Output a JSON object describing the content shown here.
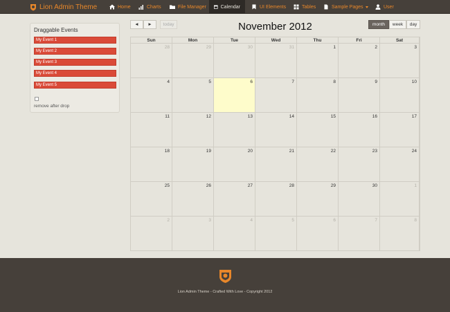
{
  "brand": {
    "name": "Lion Admin Theme",
    "color": "#e8872a"
  },
  "nav": {
    "items": [
      {
        "label": "Home",
        "icon": "home-icon"
      },
      {
        "label": "Charts",
        "icon": "chart-icon"
      },
      {
        "label": "File Manager",
        "icon": "folder-icon"
      },
      {
        "label": "Calendar",
        "icon": "calendar-icon",
        "active": true
      },
      {
        "label": "UI Elements",
        "icon": "bookmark-icon"
      },
      {
        "label": "Tables",
        "icon": "table-icon"
      },
      {
        "label": "Sample Pages",
        "icon": "file-icon",
        "dropdown": true
      },
      {
        "label": "User",
        "icon": "user-icon"
      }
    ]
  },
  "sidebar": {
    "title": "Draggable Events",
    "events": [
      "My Event 1",
      "My Event 2",
      "My Event 3",
      "My Event 4",
      "My Event 5"
    ],
    "remove_label": "remove after drop",
    "remove_checked": false,
    "event_color": "#da4a38"
  },
  "calendar": {
    "title": "November 2012",
    "prev_symbol": "◄",
    "next_symbol": "►",
    "today_label": "today",
    "views": [
      "month",
      "week",
      "day"
    ],
    "active_view": "month",
    "weekdays": [
      "Sun",
      "Mon",
      "Tue",
      "Wed",
      "Thu",
      "Fri",
      "Sat"
    ],
    "weeks": [
      [
        28,
        29,
        30,
        31,
        1,
        2,
        3
      ],
      [
        4,
        5,
        6,
        7,
        8,
        9,
        10
      ],
      [
        11,
        12,
        13,
        14,
        15,
        16,
        17
      ],
      [
        18,
        19,
        20,
        21,
        22,
        23,
        24
      ],
      [
        25,
        26,
        27,
        28,
        29,
        30,
        1
      ],
      [
        2,
        3,
        4,
        5,
        6,
        7,
        8
      ]
    ],
    "today": 6,
    "today_color": "#fefccb"
  },
  "footer": {
    "text": "Lion Admin Theme - Crafted With Love - Copyright 2012"
  }
}
